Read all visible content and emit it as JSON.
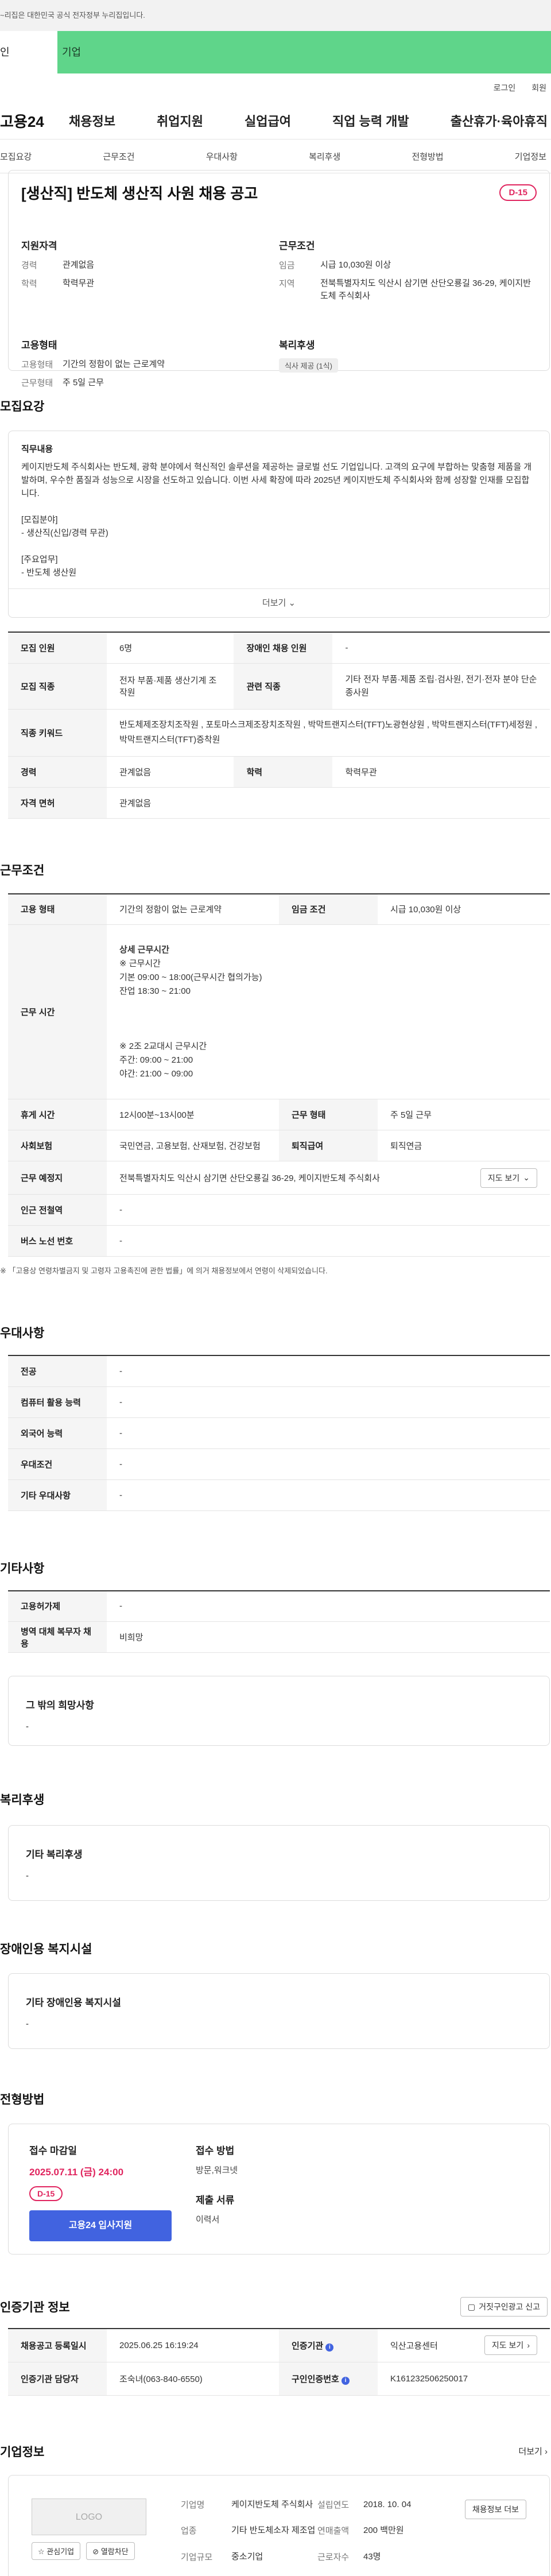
{
  "gov_banner": "~리집은 대한민국 공식 전자정부 누리집입니다.",
  "tabs": {
    "individual": "인",
    "corporate": "기업"
  },
  "util": {
    "login": "로그인",
    "join": "회원"
  },
  "gnb": {
    "logo": "고용24",
    "menu": [
      "채용정보",
      "취업지원",
      "실업급여",
      "직업 능력 개발",
      "출산휴가·육아휴직"
    ]
  },
  "subnav": [
    "모집요강",
    "근무조건",
    "우대사항",
    "복리후생",
    "전형방법",
    "기업정보"
  ],
  "job": {
    "title": "[생산직] 반도체 생산직 사원 채용 공고",
    "dday": "D-15",
    "qualification": {
      "heading": "지원자격",
      "career_k": "경력",
      "career_v": "관계없음",
      "edu_k": "학력",
      "edu_v": "학력무관"
    },
    "conditions": {
      "heading": "근무조건",
      "wage_k": "임금",
      "wage_v": "시급 10,030원 이상",
      "area_k": "지역",
      "area_v": "전북특별자치도 익산시 삼기면 산단오룡길 36-29, 케이지반도체 주식회사"
    },
    "employment": {
      "heading": "고용형태",
      "type_k": "고용형태",
      "type_v": "기간의 정함이 없는 근로계약",
      "form_k": "근무형태",
      "form_v": "주 5일 근무"
    },
    "welfare": {
      "heading": "복리후생",
      "pill": "식사 제공 (1식)"
    }
  },
  "recruit": {
    "section_title": "모집요강",
    "sub": "직무내용",
    "lines": [
      "케이지반도체 주식회사는 반도체, 광학 분야에서 혁신적인 솔루션을 제공하는 글로벌 선도 기업입니다. 고객의 요구에 부합하는 맞춤형 제품을 개발하며, 우수한 품질과 성능으로 시장을 선도하고 있습니다. 이번 사세 확장에 따라 2025년 케이지반도체 주식회사와 함께 성장할 인재를 모집합니다.",
      "",
      "[모집분야]",
      "- 생산직(신입/경력 무관)",
      "",
      "[주요업무]",
      "- 반도체 생산원"
    ],
    "more": "더보기 ⌄",
    "rows": [
      {
        "k1": "모집 인원",
        "v1": "6명",
        "k2": "장애인 채용 인원",
        "v2": "-"
      },
      {
        "k1": "모집 직종",
        "v1": "전자 부품·제품 생산기계 조작원",
        "k2": "관련 직종",
        "v2": "기타 전자 부품·제품 조립·검사원, 전기·전자 분야 단순 종사원"
      },
      {
        "k1": "직종 키워드",
        "v1": "반도체제조장치조작원 , 포토마스크제조장치조작원 , 박막트랜지스터(TFT)노광현상원 , 박막트랜지스터(TFT)세정원 , 박막트랜지스터(TFT)증착원"
      },
      {
        "k1": "경력",
        "v1": "관계없음",
        "k2": "학력",
        "v2": "학력무관"
      },
      {
        "k1": "자격 면허",
        "v1": "관계없음"
      }
    ]
  },
  "work": {
    "section_title": "근무조건",
    "type_k": "고용 형태",
    "type_v": "기간의 정함이 없는 근로계약",
    "wage_k": "임금 조건",
    "wage_v": "시급 10,030원 이상",
    "hours_k": "근무 시간",
    "hours_lines": [
      "상세 근무시간",
      "※ 근무시간",
      "기본 09:00 ~ 18:00(근무시간 협의가능)",
      "잔업 18:30 ~ 21:00",
      "",
      "",
      "",
      "※ 2조 2교대시 근무시간",
      "주간: 09:00 ~ 21:00",
      "야간: 21:00 ~ 09:00"
    ],
    "break_k": "휴게 시간",
    "break_v": "12시00분~13시00분",
    "form_k": "근무 형태",
    "form_v": "주 5일 근무",
    "insurance_k": "사회보험",
    "insurance_v": "국민연금, 고용보험, 산재보험, 건강보험",
    "severance_k": "퇴직급여",
    "severance_v": "퇴직연금",
    "place_k": "근무 예정지",
    "place_v": "전북특별자치도 익산시 삼기면 산단오룡길 36-29, 케이지반도체 주식회사",
    "map_btn": "지도 보기",
    "subway_k": "인근 전철역",
    "subway_v": "-",
    "bus_k": "버스 노선 번호",
    "bus_v": "-",
    "note": "※ 「고용상 연령차별금지 및 고령자 고용촉진에 관한 법률」에 의거 채용정보에서 연령이 삭제되었습니다."
  },
  "prefer": {
    "section_title": "우대사항",
    "rows": [
      {
        "k": "전공",
        "v": "-"
      },
      {
        "k": "컴퓨터 활용 능력",
        "v": "-"
      },
      {
        "k": "외국어 능력",
        "v": "-"
      },
      {
        "k": "우대조건",
        "v": "-"
      },
      {
        "k": "기타 우대사항",
        "v": "-"
      }
    ]
  },
  "other": {
    "section_title": "기타사항",
    "rows": [
      {
        "k": "고용허가제",
        "v": "-"
      },
      {
        "k": "병역 대체 복무자 채용",
        "v": "비희망"
      }
    ],
    "box_title": "그 밖의 희망사항",
    "box_value": "-"
  },
  "welfare": {
    "section_title": "복리후생",
    "box_title": "기타 복리후생",
    "box_value": "-"
  },
  "disabled": {
    "section_title": "장애인용 복지시설",
    "box_title": "기타 장애인용 복지시설",
    "box_value": "-"
  },
  "apply": {
    "section_title": "전형방법",
    "deadline_title": "접수 마감일",
    "deadline": "2025.07.11 (금) 24:00",
    "dday": "D-15",
    "button": "고용24 입사지원",
    "method_title": "접수 방법",
    "method": "방문,워크넷",
    "docs_title": "제출 서류",
    "docs": "이력서"
  },
  "agency": {
    "section_title": "인증기관 정보",
    "report_btn": "거짓구인광고 신고",
    "row1": {
      "k1": "채용공고 등록일시",
      "v1": "2025.06.25 16:19:24",
      "k2": "인증기관",
      "v2": "익산고용센터",
      "map_btn": "지도 보기"
    },
    "row2": {
      "k1": "인증기관 담당자",
      "v1": "조숙녀(063-840-6550)",
      "k2": "구인인증번호",
      "v2": "K161232506250017"
    }
  },
  "company": {
    "section_title": "기업정보",
    "more": "더보기",
    "logo": "LOGO",
    "interest_btn": "관심기업",
    "block_btn": "열람차단",
    "name_k": "기업명",
    "name_v": "케이지반도체 주식회사",
    "industry_k": "업종",
    "industry_v": "기타 반도체소자 제조업",
    "size_k": "기업규모",
    "size_v": "중소기업",
    "founded_k": "설립연도",
    "founded_v": "2018. 10. 04",
    "revenue_k": "연매출액",
    "revenue_v": "200 백만원",
    "employees_k": "근로자수",
    "employees_v": "43명",
    "jobs_btn": "채용정보 더보"
  }
}
